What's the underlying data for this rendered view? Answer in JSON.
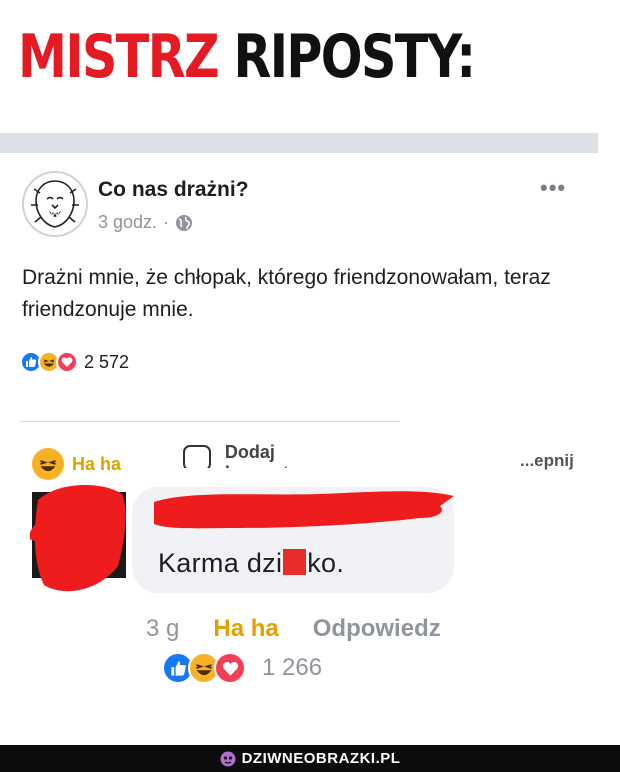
{
  "header": {
    "title_red": "MISTRZ",
    "title_black": "RIPOSTY:"
  },
  "post": {
    "page_name": "Co nas drażni?",
    "time": "3 godz.",
    "separator": "·",
    "more_icon": "•••",
    "text": "Drażni mnie, że chłopak, którego friendzonowałam, teraz friendzonuje mnie.",
    "reaction_count": "2 572",
    "reaction_icons": [
      "like-icon",
      "haha-icon",
      "love-icon"
    ]
  },
  "actions": {
    "haha_label": "Ha ha",
    "comment_label": "Dodaj komentarz",
    "share_label": "...epnij"
  },
  "comment": {
    "text_before": "Karma dzi",
    "text_after": "ko.",
    "time": "3 g",
    "haha_label": "Ha ha",
    "reply_label": "Odpowiedz",
    "reaction_count": "1 266"
  },
  "footer": {
    "site": "DZIWNEOBRAZKI.PL"
  },
  "colors": {
    "title_red": "#e41b23",
    "haha_yellow": "#e0a100",
    "like_blue": "#1877f2",
    "love_red": "#f33e58",
    "censor_red": "#e82c2c"
  }
}
